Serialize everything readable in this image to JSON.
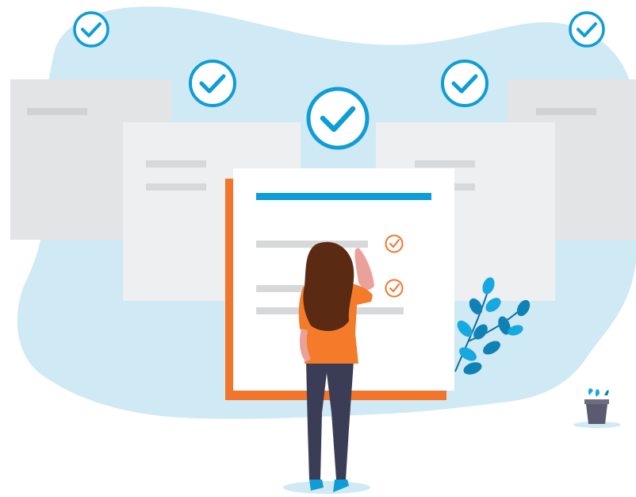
{
  "illustration": {
    "theme": "checklist-review",
    "colors": {
      "background": "#ffffff",
      "blob": "#cfe9f5",
      "card_back": "#e3e4e6",
      "card_middle": "#edeff0",
      "card_front": "#ffffff",
      "placeholder_line": "#d6d8da",
      "accent_blue": "#0e9dd6",
      "accent_orange": "#f2752b",
      "hair": "#5a2a12",
      "shirt": "#f47b2a",
      "pants": "#3a3d55",
      "skin": "#eaa19b",
      "leaf_dark": "#0f82b5",
      "leaf_light": "#16a8e0",
      "pot": "#5b5a6e"
    },
    "badges": [
      {
        "name": "check-badge-top-left",
        "icon": "checkmark-icon"
      },
      {
        "name": "check-badge-top-right",
        "icon": "checkmark-icon"
      },
      {
        "name": "check-badge-left",
        "icon": "checkmark-icon"
      },
      {
        "name": "check-badge-center",
        "icon": "checkmark-icon"
      },
      {
        "name": "check-badge-right",
        "icon": "checkmark-icon"
      }
    ],
    "checklist": {
      "checked_items": 2
    },
    "figure": "woman-figure",
    "plant": "plant-branch",
    "pot": "potted-plant"
  }
}
